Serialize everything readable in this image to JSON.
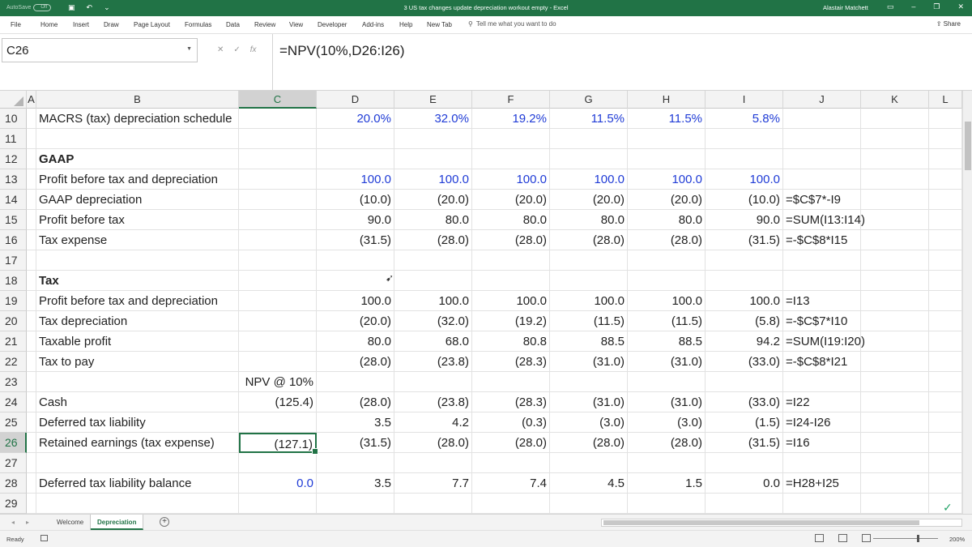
{
  "titlebar": {
    "autosave_label": "AutoSave",
    "autosave_state": "Off",
    "title": "3 US tax changes update depreciation workout empty  -  Excel",
    "user": "Alastair Matchett"
  },
  "menu": {
    "tabs": [
      "File",
      "Home",
      "Insert",
      "Draw",
      "Page Layout",
      "Formulas",
      "Data",
      "Review",
      "View",
      "Developer",
      "Add-ins",
      "Help",
      "New Tab"
    ],
    "tell_me": "Tell me what you want to do",
    "share": "Share"
  },
  "formula_bar": {
    "name_box": "C26",
    "formula": "=NPV(10%,D26:I26)"
  },
  "columns": [
    "A",
    "B",
    "C",
    "D",
    "E",
    "F",
    "G",
    "H",
    "I",
    "J",
    "K",
    "L"
  ],
  "selected_column": "C",
  "selected_row": "26",
  "rows": [
    {
      "n": "10",
      "B": "MACRS (tax) depreciation schedule",
      "C": "",
      "D": "20.0%",
      "E": "32.0%",
      "F": "19.2%",
      "G": "11.5%",
      "H": "11.5%",
      "I": "5.8%",
      "J": "",
      "blue": true
    },
    {
      "n": "11",
      "B": "",
      "C": "",
      "D": "",
      "E": "",
      "F": "",
      "G": "",
      "H": "",
      "I": "",
      "J": ""
    },
    {
      "n": "12",
      "B": "GAAP",
      "C": "",
      "D": "",
      "E": "",
      "F": "",
      "G": "",
      "H": "",
      "I": "",
      "J": "",
      "bold": true
    },
    {
      "n": "13",
      "B": "Profit before tax and depreciation",
      "C": "",
      "D": "100.0",
      "E": "100.0",
      "F": "100.0",
      "G": "100.0",
      "H": "100.0",
      "I": "100.0",
      "J": "",
      "blue": true
    },
    {
      "n": "14",
      "B": "GAAP depreciation",
      "C": "",
      "D": "(10.0)",
      "E": "(20.0)",
      "F": "(20.0)",
      "G": "(20.0)",
      "H": "(20.0)",
      "I": "(10.0)",
      "J": "=$C$7*-I9"
    },
    {
      "n": "15",
      "B": "Profit before tax",
      "C": "",
      "D": "90.0",
      "E": "80.0",
      "F": "80.0",
      "G": "80.0",
      "H": "80.0",
      "I": "90.0",
      "J": "=SUM(I13:I14)"
    },
    {
      "n": "16",
      "B": "Tax expense",
      "C": "",
      "D": "(31.5)",
      "E": "(28.0)",
      "F": "(28.0)",
      "G": "(28.0)",
      "H": "(28.0)",
      "I": "(31.5)",
      "J": "=-$C$8*I15"
    },
    {
      "n": "17",
      "B": "",
      "C": "",
      "D": "",
      "E": "",
      "F": "",
      "G": "",
      "H": "",
      "I": "",
      "J": ""
    },
    {
      "n": "18",
      "B": "Tax",
      "C": "",
      "D": "",
      "E": "",
      "F": "",
      "G": "",
      "H": "",
      "I": "",
      "J": "",
      "bold": true
    },
    {
      "n": "19",
      "B": "Profit before tax and depreciation",
      "C": "",
      "D": "100.0",
      "E": "100.0",
      "F": "100.0",
      "G": "100.0",
      "H": "100.0",
      "I": "100.0",
      "J": "=I13"
    },
    {
      "n": "20",
      "B": "Tax depreciation",
      "C": "",
      "D": "(20.0)",
      "E": "(32.0)",
      "F": "(19.2)",
      "G": "(11.5)",
      "H": "(11.5)",
      "I": "(5.8)",
      "J": "=-$C$7*I10"
    },
    {
      "n": "21",
      "B": "Taxable profit",
      "C": "",
      "D": "80.0",
      "E": "68.0",
      "F": "80.8",
      "G": "88.5",
      "H": "88.5",
      "I": "94.2",
      "J": "=SUM(I19:I20)"
    },
    {
      "n": "22",
      "B": "Tax to pay",
      "C": "",
      "D": "(28.0)",
      "E": "(23.8)",
      "F": "(28.3)",
      "G": "(31.0)",
      "H": "(31.0)",
      "I": "(33.0)",
      "J": "=-$C$8*I21"
    },
    {
      "n": "23",
      "B": "",
      "C": "NPV @ 10%",
      "D": "",
      "E": "",
      "F": "",
      "G": "",
      "H": "",
      "I": "",
      "J": ""
    },
    {
      "n": "24",
      "B": "Cash",
      "C": "(125.4)",
      "D": "(28.0)",
      "E": "(23.8)",
      "F": "(28.3)",
      "G": "(31.0)",
      "H": "(31.0)",
      "I": "(33.0)",
      "J": "=I22"
    },
    {
      "n": "25",
      "B": "Deferred tax liability",
      "C": "",
      "D": "3.5",
      "E": "4.2",
      "F": "(0.3)",
      "G": "(3.0)",
      "H": "(3.0)",
      "I": "(1.5)",
      "J": "=I24-I26"
    },
    {
      "n": "26",
      "B": "Retained earnings (tax expense)",
      "C": "(127.1)",
      "D": "(31.5)",
      "E": "(28.0)",
      "F": "(28.0)",
      "G": "(28.0)",
      "H": "(28.0)",
      "I": "(31.5)",
      "J": "=I16"
    },
    {
      "n": "27",
      "B": "",
      "C": "",
      "D": "",
      "E": "",
      "F": "",
      "G": "",
      "H": "",
      "I": "",
      "J": ""
    },
    {
      "n": "28",
      "B": "Deferred tax liability balance",
      "C": "0.0",
      "D": "3.5",
      "E": "7.7",
      "F": "7.4",
      "G": "4.5",
      "H": "1.5",
      "I": "0.0",
      "J": "=H28+I25",
      "c_blue": true
    },
    {
      "n": "29",
      "B": "",
      "C": "",
      "D": "",
      "E": "",
      "F": "",
      "G": "",
      "H": "",
      "I": "",
      "J": ""
    }
  ],
  "sheets": [
    {
      "name": "Welcome",
      "active": false
    },
    {
      "name": "Depreciation",
      "active": true
    }
  ],
  "status": {
    "ready": "Ready",
    "zoom": "200%"
  },
  "colors": {
    "excel_green": "#217346",
    "input_blue": "#1f3bd6"
  }
}
